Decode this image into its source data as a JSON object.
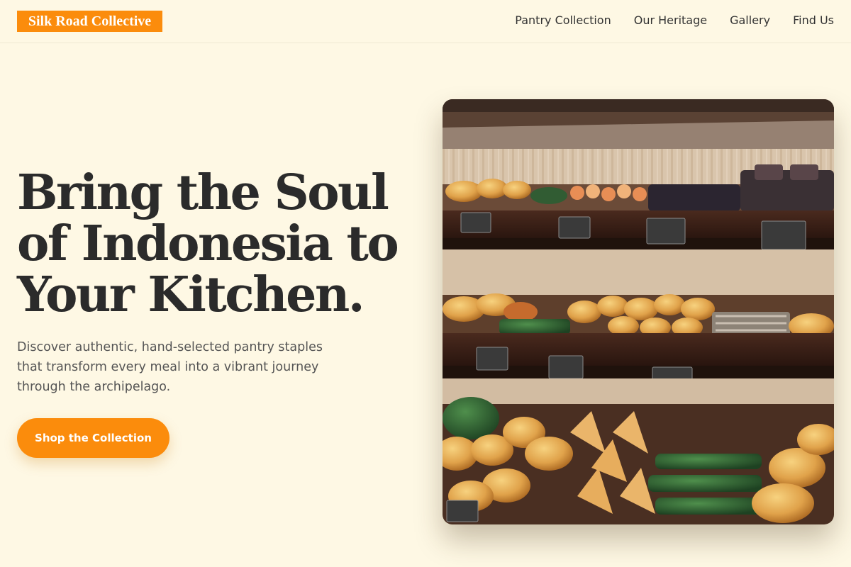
{
  "header": {
    "brand": "Silk Road Collective",
    "nav": [
      {
        "label": "Pantry Collection"
      },
      {
        "label": "Our Heritage"
      },
      {
        "label": "Gallery"
      },
      {
        "label": "Find Us"
      }
    ]
  },
  "hero": {
    "title": "Bring the Soul of Indonesia to Your Kitchen.",
    "subtitle": "Discover authentic, hand-selected pantry staples that transform every meal into a vibrant journey through the archipelago.",
    "cta_label": "Shop the Collection"
  },
  "colors": {
    "accent": "#fb8c0c",
    "background": "#fef8e4",
    "text": "#2b2b2b"
  }
}
